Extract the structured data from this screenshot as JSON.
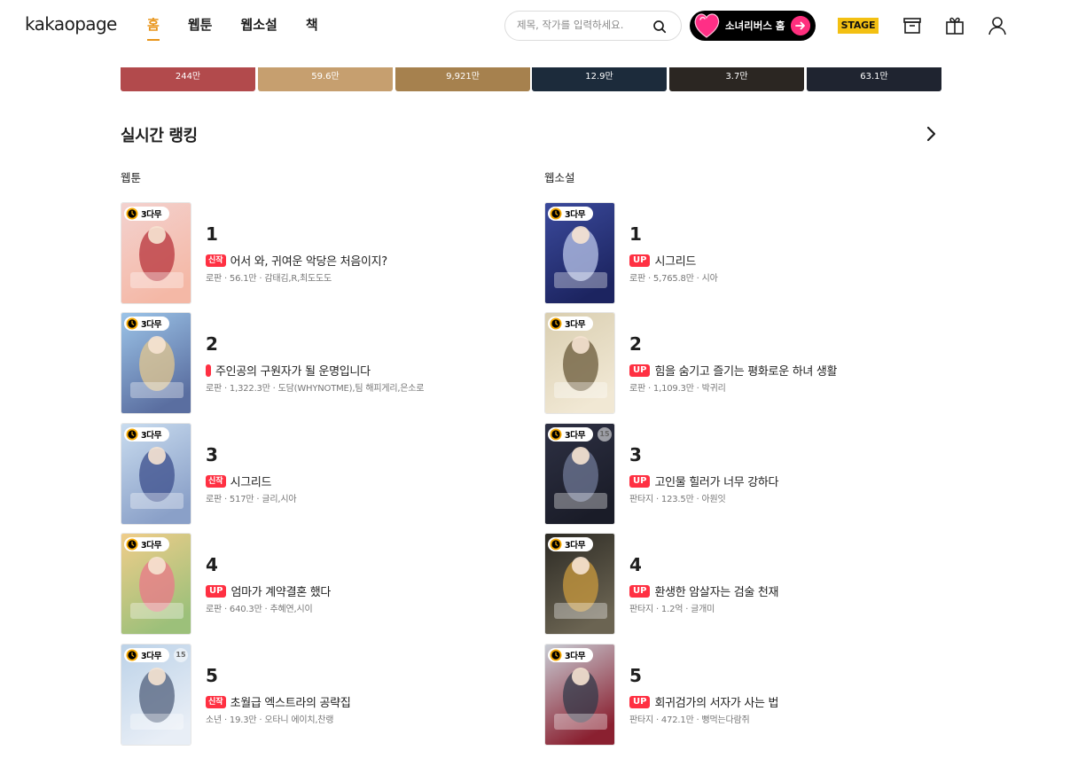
{
  "header": {
    "logo": "kakaopage",
    "nav": [
      {
        "label": "홈",
        "active": true
      },
      {
        "label": "웹툰",
        "active": false
      },
      {
        "label": "웹소설",
        "active": false
      },
      {
        "label": "책",
        "active": false
      }
    ],
    "search_placeholder": "제목, 작가를 입력하세요.",
    "promo_label": "소녀리버스 홈",
    "stage_label": "STAGE",
    "icons": [
      "archive-icon",
      "gift-icon",
      "user-icon"
    ]
  },
  "top_strip": [
    "244만",
    "59.6만",
    "9,921만",
    "12.9만",
    "3.7만",
    "63.1만"
  ],
  "section": {
    "title": "실시간 랭킹",
    "webtoon_label": "웹툰",
    "webnovel_label": "웹소설"
  },
  "wait_badge": "3다무",
  "webtoon": [
    {
      "rank": "1",
      "tag": "신작",
      "title": "어서 와, 귀여운 악당은 처음이지?",
      "meta": "로판 · 56.1만 · 감태김,R,최도도도",
      "age": ""
    },
    {
      "rank": "2",
      "tag": "",
      "title": "주인공의 구원자가 될 운명입니다",
      "meta": "로판 · 1,322.3만 · 도담(WHYNOTME),팀 해피게리,은소로",
      "age": ""
    },
    {
      "rank": "3",
      "tag": "신작",
      "title": "시그리드",
      "meta": "로판 · 517만 · 글리,시아",
      "age": ""
    },
    {
      "rank": "4",
      "tag": "UP",
      "title": "엄마가 계약결혼 했다",
      "meta": "로판 · 640.3만 · 추혜연,시이",
      "age": ""
    },
    {
      "rank": "5",
      "tag": "신작",
      "title": "초월급 엑스트라의 공략집",
      "meta": "소년 · 19.3만 · 오타니 에이치,찬랭",
      "age": "15"
    }
  ],
  "webnovel": [
    {
      "rank": "1",
      "tag": "UP",
      "title": "시그리드",
      "meta": "로판 · 5,765.8만 · 시아",
      "age": ""
    },
    {
      "rank": "2",
      "tag": "UP",
      "title": "힘을 숨기고 즐기는 평화로운 하녀 생활",
      "meta": "로판 · 1,109.3만 · 박귀리",
      "age": ""
    },
    {
      "rank": "3",
      "tag": "UP",
      "title": "고인물 힐러가 너무 강하다",
      "meta": "판타지 · 123.5만 · 아원잇",
      "age": "15"
    },
    {
      "rank": "4",
      "tag": "UP",
      "title": "환생한 암살자는 검술 천재",
      "meta": "판타지 · 1.2억 · 글개미",
      "age": ""
    },
    {
      "rank": "5",
      "tag": "UP",
      "title": "회귀검가의 서자가 사는 법",
      "meta": "판타지 · 472.1만 · 뻥먹는다람쥐",
      "age": ""
    }
  ],
  "colors": {
    "accent": "#e8951b",
    "tag_red": "#ff3042",
    "promo_pink": "#ff2f7e",
    "stage_yellow": "#f3c012",
    "strip": [
      "#b24a4c",
      "#c69f6f",
      "#a6814e",
      "#1c2b3b",
      "#2b2622",
      "#1f2430"
    ]
  }
}
